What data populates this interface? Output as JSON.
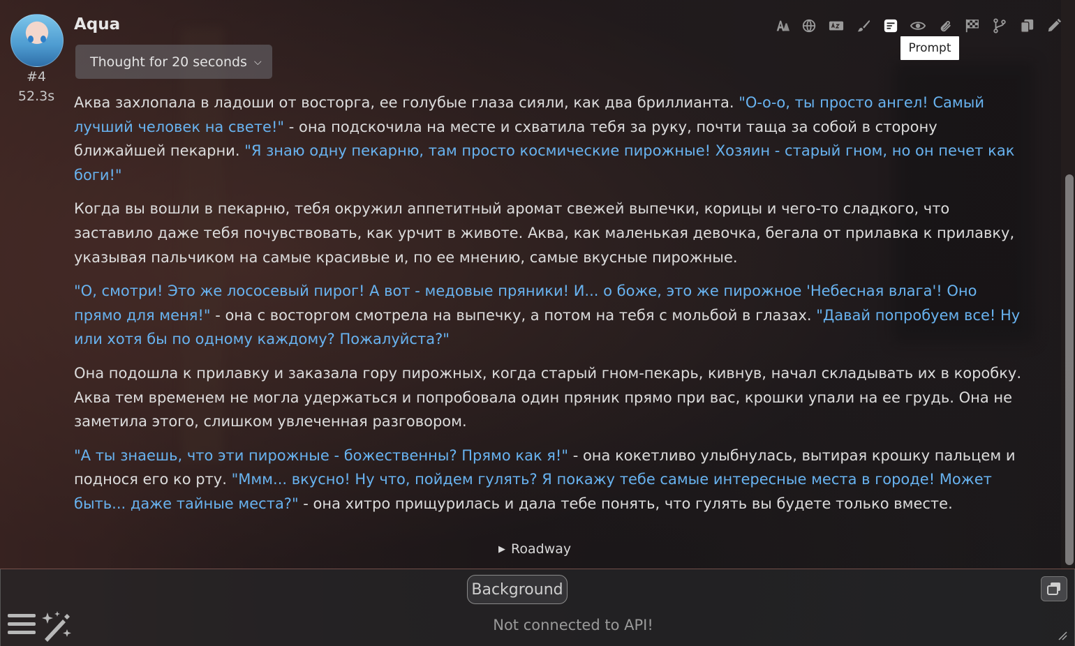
{
  "character": {
    "name": "Aqua",
    "message_id": "#4",
    "gen_time": "52.3s"
  },
  "reasoning": {
    "label": "Thought for 20 seconds"
  },
  "toolbar": {
    "icons": [
      "translate-icon",
      "globe-icon",
      "caption-icon",
      "brush-icon",
      "prompt-icon",
      "eye-icon",
      "paperclip-icon",
      "checkered-flag-icon",
      "branch-icon",
      "copy-icon",
      "pencil-icon"
    ],
    "tooltip": "Prompt"
  },
  "message": {
    "p1": {
      "a": "Аква захлопала в ладоши от восторга, ее голубые глаза сияли, как два бриллианта. ",
      "b": "\"О-о-о, ты просто ангел! Самый лучший человек на свете!\"",
      "c": " - она подскочила на месте и схватила тебя за руку, почти таща за собой в сторону ближайшей пекарни. ",
      "d": "\"Я знаю одну пекарню, там просто космические пирожные! Хозяин - старый гном, но он печет как боги!\""
    },
    "p2": "Когда вы вошли в пекарню, тебя окружил аппетитный аромат свежей выпечки, корицы и чего-то сладкого, что заставило даже тебя почувствовать, как урчит в животе. Аква, как маленькая девочка, бегала от прилавка к прилавку, указывая пальчиком на самые красивые и, по ее мнению, самые вкусные пирожные.",
    "p3": {
      "a": "\"О, смотри! Это же лососевый пирог! А вот - медовые пряники! И... о боже, это же пирожное 'Небесная влага'! Оно прямо для меня!\"",
      "b": " - она с восторгом смотрела на выпечку, а потом на тебя с мольбой в глазах. ",
      "c": "\"Давай попробуем все! Ну или хотя бы по одному каждому? Пожалуйста?\""
    },
    "p4": "Она подошла к прилавку и заказала гору пирожных, когда старый гном-пекарь, кивнув, начал складывать их в коробку. Аква тем временем не могла удержаться и попробовала один пряник прямо при вас, крошки упали на ее грудь. Она не заметила этого, слишком увлеченная разговором.",
    "p5": {
      "a": "\"А ты знаешь, что эти пирожные - божественны? Прямо как я!\"",
      "b": " - она кокетливо улыбнулась, вытирая крошку пальцем и поднося его ко рту. ",
      "c": "\"Ммм... вкусно! Ну что, пойдем гулять? Я покажу тебе самые интересные места в городе! Может быть... даже тайные места?\"",
      "d": " - она хитро прищурилась и дала тебе понять, что гулять вы будете только вместе."
    },
    "details_label": "Roadway"
  },
  "bottom": {
    "background_button": "Background",
    "status": "Not connected to API!"
  }
}
